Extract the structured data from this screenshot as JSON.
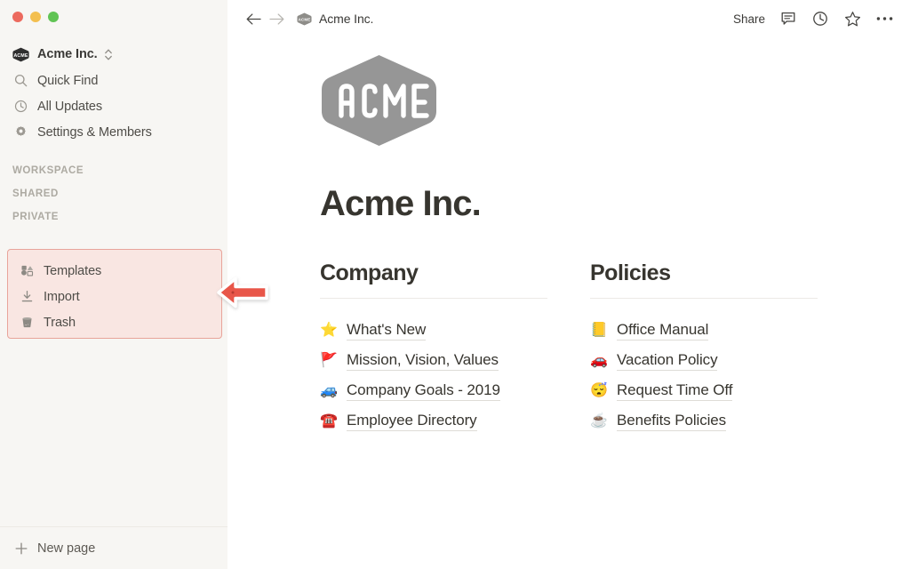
{
  "window": {
    "traffic_lights": [
      "close",
      "minimize",
      "zoom"
    ],
    "colors": {
      "close": "#ec6a5e",
      "minimize": "#f3bf4f",
      "zoom": "#61c454",
      "sidebar_bg": "#f7f6f3",
      "highlight_fill": "#f9e6e2",
      "highlight_border": "#e8a49a",
      "annotation_arrow": "#e8564a",
      "logo_gray": "#969696",
      "text_primary": "#37352f"
    }
  },
  "sidebar": {
    "workspace": {
      "name": "Acme Inc.",
      "logo_text": "ACME",
      "logo_icon": "acme-hexagon-icon",
      "switcher_icon": "chevron-updown-icon"
    },
    "nav": [
      {
        "label": "Quick Find",
        "icon": "search-icon"
      },
      {
        "label": "All Updates",
        "icon": "clock-icon"
      },
      {
        "label": "Settings & Members",
        "icon": "gear-icon"
      }
    ],
    "sections": [
      {
        "label": "WORKSPACE"
      },
      {
        "label": "SHARED"
      },
      {
        "label": "PRIVATE"
      }
    ],
    "highlighted_group": [
      {
        "label": "Templates",
        "icon": "templates-icon"
      },
      {
        "label": "Import",
        "icon": "import-download-icon"
      },
      {
        "label": "Trash",
        "icon": "trash-icon"
      }
    ],
    "footer": {
      "label": "New page",
      "icon": "plus-icon"
    }
  },
  "topbar": {
    "back_icon": "arrow-left-icon",
    "forward_icon": "arrow-right-icon",
    "breadcrumb": {
      "label": "Acme Inc.",
      "icon": "acme-hexagon-icon"
    },
    "share_label": "Share",
    "icons": [
      {
        "name": "comment-icon"
      },
      {
        "name": "clock-history-icon"
      },
      {
        "name": "star-favorite-icon"
      },
      {
        "name": "more-options-icon"
      }
    ]
  },
  "page": {
    "cover_logo_text": "ACME",
    "title": "Acme Inc.",
    "columns": [
      {
        "heading": "Company",
        "links": [
          {
            "emoji": "⭐",
            "emoji_name": "star-emoji",
            "label": "What's New"
          },
          {
            "emoji": "🚩",
            "emoji_name": "triangular-flag-emoji",
            "label": "Mission, Vision, Values"
          },
          {
            "emoji": "🚙",
            "emoji_name": "recreational-vehicle-emoji",
            "label": "Company Goals - 2019"
          },
          {
            "emoji": "☎️",
            "emoji_name": "telephone-emoji",
            "label": "Employee Directory"
          }
        ]
      },
      {
        "heading": "Policies",
        "links": [
          {
            "emoji": "📒",
            "emoji_name": "ledger-emoji",
            "label": "Office Manual"
          },
          {
            "emoji": "🚗",
            "emoji_name": "car-emoji",
            "label": "Vacation Policy"
          },
          {
            "emoji": "😴",
            "emoji_name": "sleeping-face-emoji",
            "label": "Request Time Off"
          },
          {
            "emoji": "☕",
            "emoji_name": "coffee-emoji",
            "label": "Benefits Policies"
          }
        ]
      }
    ]
  },
  "annotation": {
    "arrow_icon": "red-left-arrow-annotation",
    "points_to": "Templates / Import / Trash group"
  }
}
